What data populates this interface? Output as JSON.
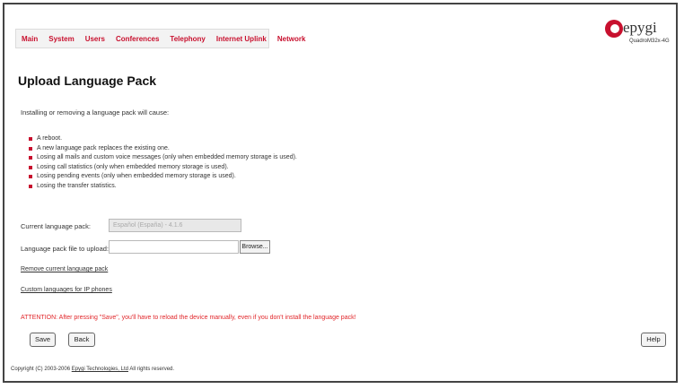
{
  "menu": {
    "items": [
      "Main",
      "System",
      "Users",
      "Conferences",
      "Telephony",
      "Internet Uplink",
      "Network"
    ]
  },
  "logo": {
    "word": "epygi",
    "model": "QuadroM32x-4G"
  },
  "page": {
    "title": "Upload Language Pack",
    "intro": "Installing or removing a language pack will cause:",
    "bullets": [
      "A reboot.",
      "A new language pack replaces the existing one.",
      "Losing all mails and custom voice messages (only when embedded memory storage is used).",
      "Losing call statistics (only when embedded memory storage is used).",
      "Losing pending events (only when embedded memory storage is used).",
      "Losing the transfer statistics."
    ]
  },
  "form": {
    "current_label": "Current language pack:",
    "current_value": "Español (España) - 4.1.6",
    "file_label": "Language pack file to upload:",
    "file_value": "",
    "browse_label": "Browse..."
  },
  "links": {
    "remove": "Remove current language pack",
    "custom": "Custom languages for IP phones"
  },
  "warning": "ATTENTION: After pressing \"Save\", you'll have to reload the device manually, even if you don't install the language pack!",
  "buttons": {
    "save": "Save",
    "back": "Back",
    "help": "Help"
  },
  "footer": {
    "prefix": "Copyright (C) 2003-2006",
    "company": "Epygi Technologies, Ltd",
    "suffix": "All rights reserved."
  },
  "colors": {
    "accent": "#c8102e",
    "warning": "#e1262a"
  }
}
